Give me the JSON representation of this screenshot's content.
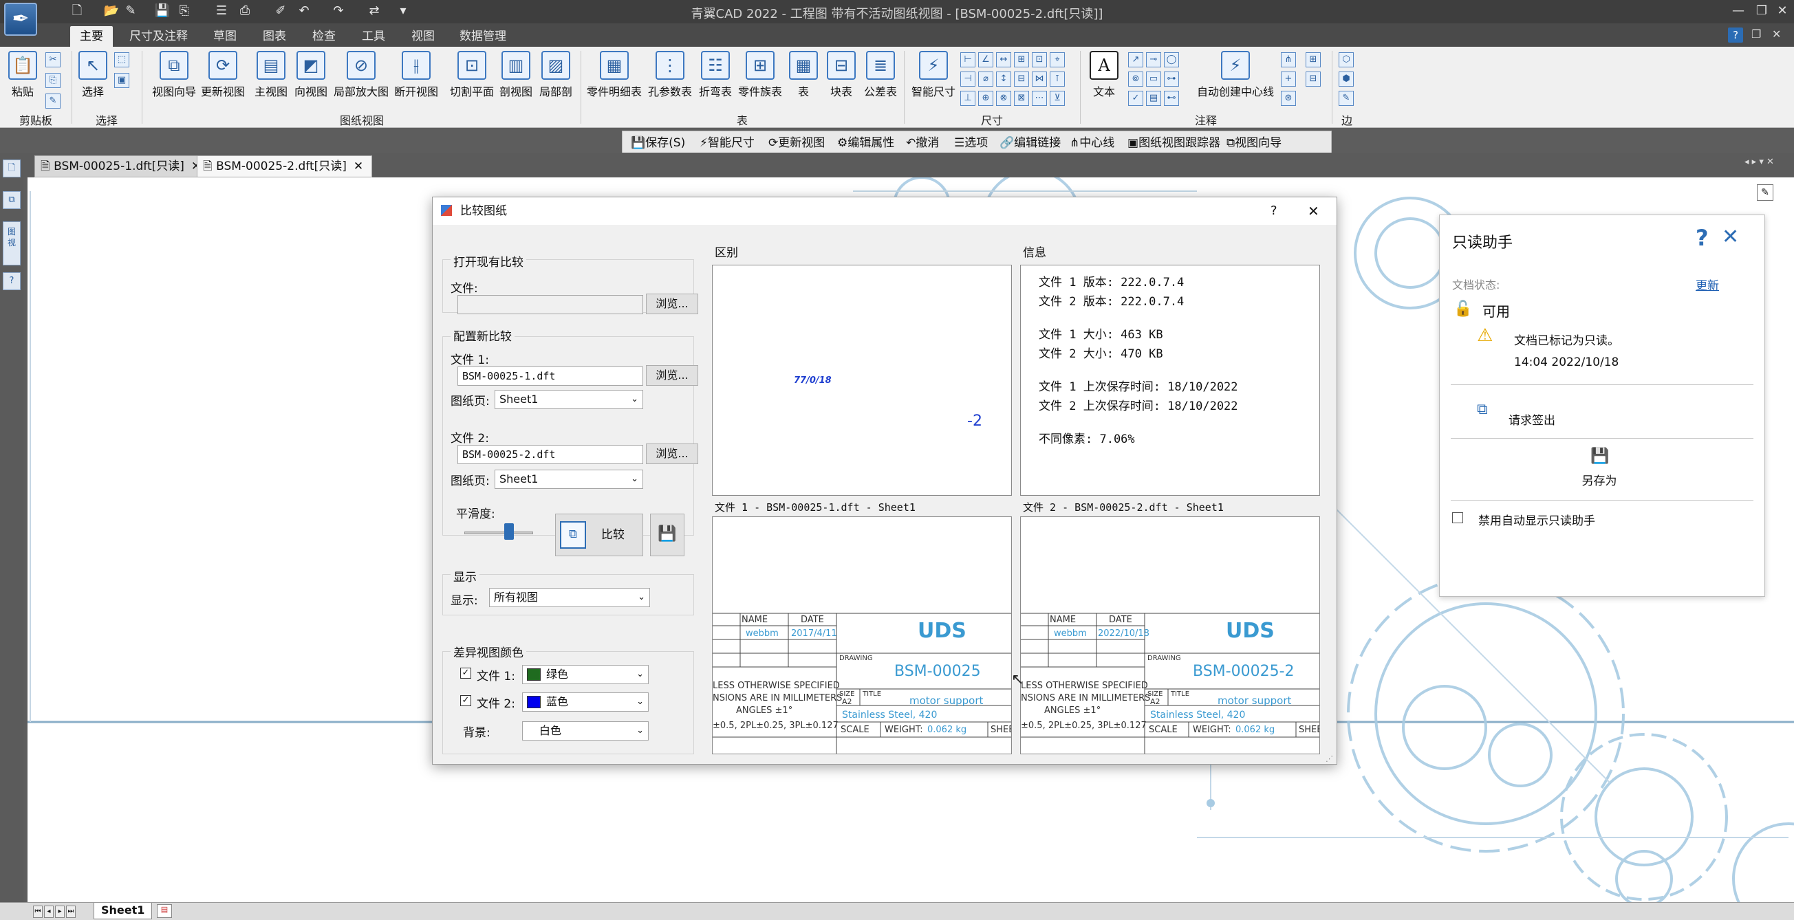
{
  "app": {
    "window_title": "青翼CAD 2022 - 工程图 带有不活动图纸视图 - [BSM-00025-2.dft[只读]]",
    "ribbon_tabs": [
      "主要",
      "尺寸及注释",
      "草图",
      "图表",
      "检查",
      "工具",
      "视图",
      "数据管理"
    ],
    "active_tab": "主要"
  },
  "ribbon": {
    "paste": "粘贴",
    "select": "选择",
    "view_wizard": "视图向导",
    "update_views": "更新视图",
    "main_view": "主视图",
    "projected_view": "向视图",
    "detail_view": "局部放大图",
    "broken_view": "断开视图",
    "cutting_plane": "切割平面",
    "section_view": "剖视图",
    "partial_section": "局部剖",
    "parts_list": "零件明细表",
    "hole_table": "孔参数表",
    "bend_table": "折弯表",
    "family_table": "零件族表",
    "table": "表",
    "block_table": "块表",
    "tolerance_table": "公差表",
    "smart_dimension": "智能尺寸",
    "text": "文本",
    "auto_centerline": "自动创建中心线",
    "groups": {
      "clipboard": "剪贴板",
      "select": "选择",
      "drawing_views": "图纸视图",
      "tables": "表",
      "dimension": "尺寸",
      "annotation": "注释",
      "edge": "边"
    }
  },
  "subtoolbar": {
    "save": "保存(S)",
    "smart_dimension": "智能尺寸",
    "update_views": "更新视图",
    "edit_properties": "编辑属性",
    "undo": "撤消",
    "options": "选项",
    "edit_links": "编辑链接",
    "centerline": "中心线",
    "view_tracker": "图纸视图跟踪器",
    "view_wizard": "视图向导"
  },
  "doc_tabs": [
    {
      "label": "BSM-00025-1.dft[只读]",
      "close": "✕"
    },
    {
      "label": "BSM-00025-2.dft[只读]",
      "close": "✕"
    }
  ],
  "sheet_tab": "Sheet1",
  "dialog": {
    "title": "比较图纸",
    "help": "?",
    "close": "✕",
    "open_existing": {
      "title": "打开现有比较",
      "file_label": "文件:",
      "file_value": "",
      "browse": "浏览..."
    },
    "configure_new": {
      "title": "配置新比较",
      "file1_label": "文件 1:",
      "file1_value": "BSM-00025-1.dft",
      "browse1": "浏览...",
      "sheet1_label": "图纸页:",
      "sheet1_value": "Sheet1",
      "file2_label": "文件 2:",
      "file2_value": "BSM-00025-2.dft",
      "browse2": "浏览...",
      "sheet2_label": "图纸页:",
      "sheet2_value": "Sheet1",
      "smoothness_label": "平滑度:",
      "smoothness_level": 0.65,
      "compare_button": "比较"
    },
    "display": {
      "title": "显示",
      "show_label": "显示:",
      "show_value": "所有视图"
    },
    "diff_colors": {
      "title": "差异视图颜色",
      "file1_label": "文件 1:",
      "file1_color_name": "绿色",
      "file1_color": "#1f6b1f",
      "file2_label": "文件 2:",
      "file2_color_name": "蓝色",
      "file2_color": "#0000ee",
      "bg_label": "背景:",
      "bg_value": "白色"
    },
    "diff_panel": {
      "title": "区别",
      "blob_text": "77/0/18",
      "suffix_text": "-2"
    },
    "info_panel": {
      "title": "信息",
      "lines": [
        "文件 1 版本: 222.0.7.4",
        "文件 2 版本: 222.0.7.4",
        "文件 1 大小: 463 KB",
        "文件 2 大小: 470 KB",
        "文件 1 上次保存时间: 18/10/2022",
        "文件 2 上次保存时间: 18/10/2022",
        "不同像素: 7.06%"
      ]
    },
    "preview1": {
      "title": "文件 1 - BSM-00025-1.dft - Sheet1",
      "col_name": "NAME",
      "col_date": "DATE",
      "name": "webbm",
      "date": "2017/4/11",
      "company": "UDS",
      "drawing_label": "DRAWING",
      "drawing": "BSM-00025",
      "note1": "LESS OTHERWISE SPECIFIED",
      "note2": "NSIONS ARE IN MILLIMETERS",
      "note3": "ANGLES ±1°",
      "note4": "±0.5, 2PL±0.25, 3PL±0.127",
      "size_label": "SIZE",
      "size": "A2",
      "title_label": "TITLE",
      "part_title": "motor support",
      "material": "Stainless Steel, 420",
      "scale_label": "SCALE",
      "weight_label": "WEIGHT:",
      "weight": "0.062 kg",
      "sheet_label": "SHEET"
    },
    "preview2": {
      "title": "文件 2 - BSM-00025-2.dft - Sheet1",
      "col_name": "NAME",
      "col_date": "DATE",
      "name": "webbm",
      "date": "2022/10/18",
      "company": "UDS",
      "drawing_label": "DRAWING",
      "drawing": "BSM-00025-2",
      "note1": "LESS OTHERWISE SPECIFIED",
      "note2": "NSIONS ARE IN MILLIMETERS",
      "note3": "ANGLES ±1°",
      "note4": "±0.5, 2PL±0.25, 3PL±0.127",
      "size_label": "SIZE",
      "size": "A2",
      "title_label": "TITLE",
      "part_title": "motor support",
      "material": "Stainless Steel, 420",
      "scale_label": "SCALE",
      "weight_label": "WEIGHT:",
      "weight": "0.062 kg",
      "sheet_label": "SHEET"
    }
  },
  "helper": {
    "title": "只读助手",
    "help": "?",
    "close": "✕",
    "status_label": "文档状态:",
    "update_link": "更新",
    "available": "可用",
    "warning": "文档已标记为只读。",
    "timestamp": "14:04  2022/10/18",
    "checkout": "请求签出",
    "save_as": "另存为",
    "disable_auto": "禁用自动显示只读助手"
  },
  "colors": {
    "accent": "#2d6db5",
    "title_block_blue": "#3a9ad1"
  }
}
